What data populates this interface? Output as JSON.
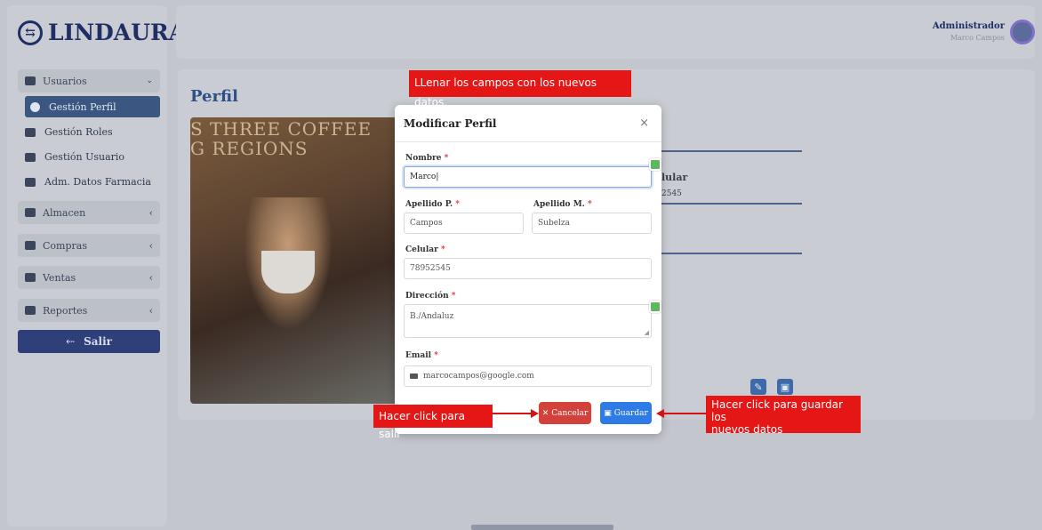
{
  "app": {
    "logo_text": "LINDAURA"
  },
  "user": {
    "name": "Administrador",
    "subtitle": "Marco Campos"
  },
  "sidebar": {
    "usuarios_label": "Usuarios",
    "items": [
      {
        "label": "Gestión Perfil"
      },
      {
        "label": "Gestión Roles"
      },
      {
        "label": "Gestión Usuario"
      },
      {
        "label": "Adm. Datos Farmacia"
      }
    ],
    "groups": [
      {
        "label": "Almacen"
      },
      {
        "label": "Compras"
      },
      {
        "label": "Ventas"
      },
      {
        "label": "Reportes"
      }
    ],
    "logout_label": "Salir"
  },
  "page": {
    "title": "Perfil",
    "photo_sign": "S THREE COFFEE\nG REGIONS",
    "bg_label_celular": "lular",
    "bg_value_celular": "2545"
  },
  "modal": {
    "title": "Modificar Perfil",
    "close": "×",
    "nombre_label": "Nombre",
    "nombre_value": "Marco",
    "apellido_p_label": "Apellido P.",
    "apellido_p_value": "Campos",
    "apellido_m_label": "Apellido M.",
    "apellido_m_value": "Subelza",
    "celular_label": "Celular",
    "celular_value": "78952545",
    "direccion_label": "Dirección",
    "direccion_value": "B./Andaluz",
    "email_label": "Email",
    "email_value": "marcocampos@google.com",
    "required_mark": "*",
    "cancel_label": "Cancelar",
    "save_label": "Guardar"
  },
  "annotations": {
    "top_note": "LLenar los campos con los nuevos datos.",
    "exit_note": "Hacer click para salir",
    "save_note_line1": "Hacer click para guardar los",
    "save_note_line2": "nuevos datos"
  },
  "colors": {
    "annotation": "#e41616",
    "primary": "#2f7be5",
    "danger": "#d3413b",
    "brand": "#1f2f66"
  }
}
